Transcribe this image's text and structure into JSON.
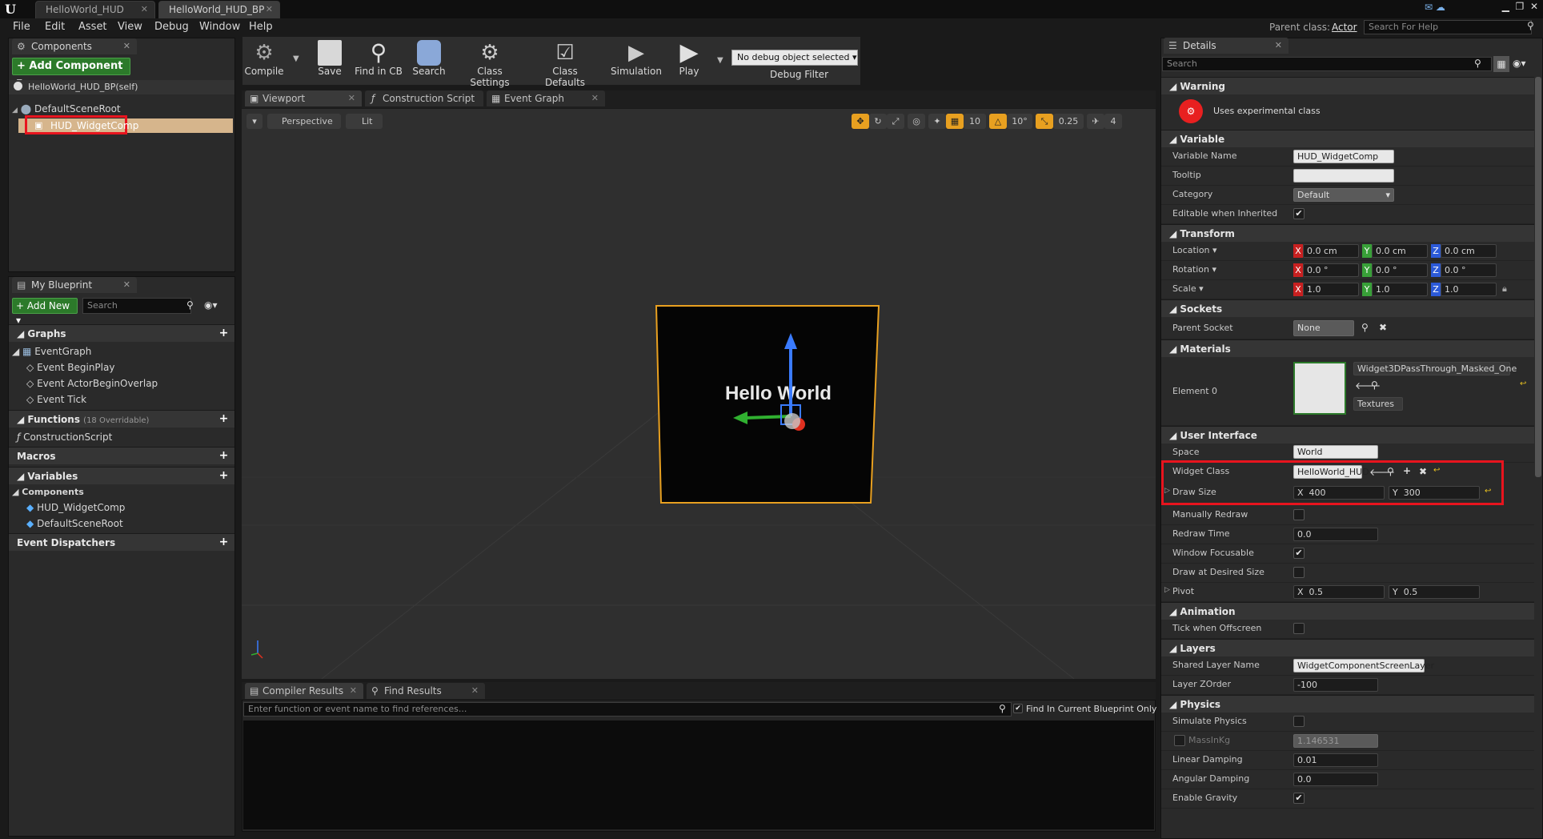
{
  "title_tabs": [
    {
      "label": "HelloWorld_HUD"
    },
    {
      "label": "HelloWorld_HUD_BP"
    }
  ],
  "menu": [
    "File",
    "Edit",
    "Asset",
    "View",
    "Debug",
    "Window",
    "Help"
  ],
  "top_right": {
    "parent_class_label": "Parent class:",
    "parent_class_value": "Actor",
    "search_help_placeholder": "Search For Help"
  },
  "components_panel": {
    "tab": "Components",
    "add_button": "+ Add Component ▾",
    "self_item": "HelloWorld_HUD_BP(self)",
    "tree": [
      "DefaultSceneRoot",
      "HUD_WidgetComp"
    ]
  },
  "my_blueprint": {
    "tab": "My Blueprint",
    "add_new": "+ Add New ▾",
    "search_placeholder": "Search",
    "graphs": {
      "label": "Graphs",
      "items": [
        "EventGraph",
        "Event BeginPlay",
        "Event ActorBeginOverlap",
        "Event Tick"
      ]
    },
    "functions": {
      "label": "Functions",
      "count": "(18 Overridable)",
      "items": [
        "ConstructionScript"
      ]
    },
    "macros": "Macros",
    "variables": {
      "label": "Variables",
      "sub": "Components",
      "items": [
        "HUD_WidgetComp",
        "DefaultSceneRoot"
      ]
    },
    "dispatchers": "Event Dispatchers"
  },
  "toolbar": {
    "buttons": [
      "Compile",
      "Save",
      "Find in CB",
      "Search",
      "Class Settings",
      "Class Defaults",
      "Simulation",
      "Play"
    ],
    "debug_select": "No debug object selected ▾",
    "debug_filter": "Debug Filter"
  },
  "editor_tabs": [
    "Viewport",
    "Construction Script",
    "Event Graph"
  ],
  "viewport": {
    "perspective": "Perspective",
    "lit": "Lit",
    "grid_snap": "10",
    "rot_snap": "10°",
    "scale_snap": "0.25",
    "cam_speed": "4",
    "hello_text": "Hello World"
  },
  "bottom": {
    "tabs": [
      "Compiler Results",
      "Find Results"
    ],
    "find_placeholder": "Enter function or event name to find references...",
    "find_current": "Find In Current Blueprint Only"
  },
  "details": {
    "tab": "Details",
    "search_placeholder": "Search",
    "warning": {
      "header": "Warning",
      "text": "Uses experimental class"
    },
    "variable": {
      "header": "Variable",
      "rows": [
        {
          "label": "Variable Name",
          "value": "HUD_WidgetComp"
        },
        {
          "label": "Tooltip",
          "value": ""
        },
        {
          "label": "Category",
          "value": "Default"
        },
        {
          "label": "Editable when Inherited",
          "value": "✔"
        }
      ]
    },
    "transform": {
      "header": "Transform",
      "location": {
        "label": "Location ▾",
        "x": "0.0 cm",
        "y": "0.0 cm",
        "z": "0.0 cm"
      },
      "rotation": {
        "label": "Rotation ▾",
        "x": "0.0 °",
        "y": "0.0 °",
        "z": "0.0 °"
      },
      "scale": {
        "label": "Scale ▾",
        "x": "1.0",
        "y": "1.0",
        "z": "1.0"
      }
    },
    "sockets": {
      "header": "Sockets",
      "label": "Parent Socket",
      "value": "None"
    },
    "materials": {
      "header": "Materials",
      "label": "Element 0",
      "value": "Widget3DPassThrough_Masked_One",
      "textures": "Textures"
    },
    "ui": {
      "header": "User Interface",
      "space": {
        "label": "Space",
        "value": "World"
      },
      "widget_class": {
        "label": "Widget Class",
        "value": "HelloWorld_HUD"
      },
      "draw_size": {
        "label": "Draw Size",
        "x": "400",
        "y": "300"
      },
      "manually_redraw": "Manually Redraw",
      "redraw_time": {
        "label": "Redraw Time",
        "value": "0.0"
      },
      "window_focusable": "Window Focusable",
      "draw_desired": "Draw at Desired Size",
      "pivot": {
        "label": "Pivot",
        "x": "0.5",
        "y": "0.5"
      }
    },
    "animation": {
      "header": "Animation",
      "label": "Tick when Offscreen"
    },
    "layers": {
      "header": "Layers",
      "shared": {
        "label": "Shared Layer Name",
        "value": "WidgetComponentScreenLayer"
      },
      "zorder": {
        "label": "Layer ZOrder",
        "value": "-100"
      }
    },
    "physics": {
      "header": "Physics",
      "simulate": "Simulate Physics",
      "mass": {
        "label": "MassInKg",
        "value": "1.146531"
      },
      "linear": {
        "label": "Linear Damping",
        "value": "0.01"
      },
      "angular": {
        "label": "Angular Damping",
        "value": "0.0"
      },
      "gravity": "Enable Gravity"
    },
    "axes": {
      "x": "X",
      "y": "Y",
      "z": "Z"
    },
    "check": "✔"
  },
  "colors": {
    "accent_red": "#e8141e",
    "selection": "#d6b58c",
    "add_green": "#2c7a2a"
  }
}
